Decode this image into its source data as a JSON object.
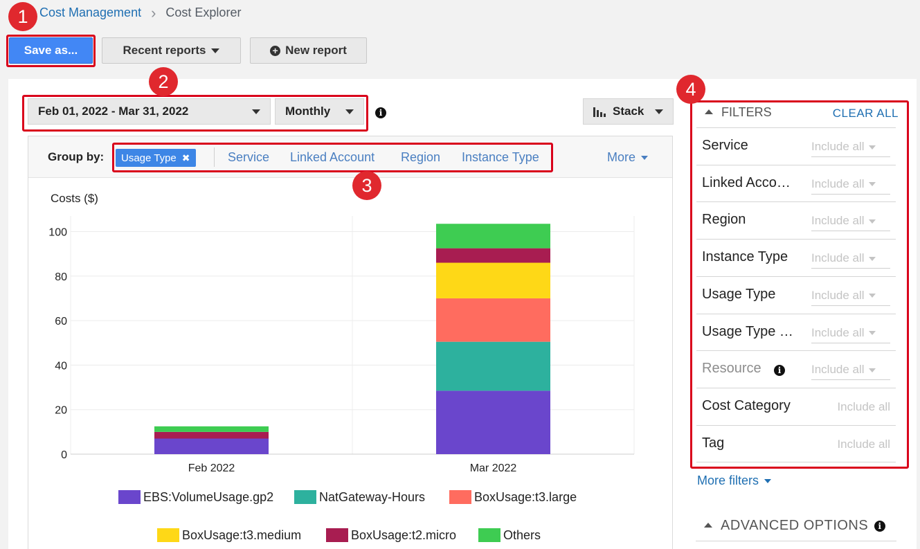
{
  "breadcrumb": {
    "parent": "Cost Management",
    "current": "Cost Explorer"
  },
  "toolbar": {
    "save_label": "Save as...",
    "recent_label": "Recent reports",
    "new_label": "New report"
  },
  "controls": {
    "date_range": "Feb 01, 2022 - Mar 31, 2022",
    "granularity": "Monthly",
    "chart_style": "Stack"
  },
  "group_by": {
    "label": "Group by:",
    "active_chip": "Usage Type",
    "options": [
      "Service",
      "Linked Account",
      "Region",
      "Instance Type"
    ],
    "more": "More"
  },
  "badges": [
    "1",
    "2",
    "3",
    "4"
  ],
  "chart_data": {
    "type": "bar",
    "stacked": true,
    "ylabel": "Costs ($)",
    "categories": [
      "Feb 2022",
      "Mar 2022"
    ],
    "yticks": [
      0,
      20,
      40,
      60,
      80,
      100
    ],
    "ylim": [
      0,
      107
    ],
    "grid": true,
    "legend_position": "bottom",
    "series": [
      {
        "name": "EBS:VolumeUsage.gp2",
        "color": "#6a46cc",
        "values": [
          7,
          28.5
        ]
      },
      {
        "name": "NatGateway-Hours",
        "color": "#2db19e",
        "values": [
          0,
          22
        ]
      },
      {
        "name": "BoxUsage:t3.large",
        "color": "#ff6c5f",
        "values": [
          0,
          19.5
        ]
      },
      {
        "name": "BoxUsage:t3.medium",
        "color": "#fed817",
        "values": [
          0,
          16
        ]
      },
      {
        "name": "BoxUsage:t2.micro",
        "color": "#a81d51",
        "values": [
          3,
          6.5
        ]
      },
      {
        "name": "Others",
        "color": "#3ecc52",
        "values": [
          2.5,
          11
        ]
      }
    ]
  },
  "filters": {
    "title": "FILTERS",
    "clear_all": "CLEAR ALL",
    "rows": [
      {
        "label": "Service",
        "value": "Include all"
      },
      {
        "label": "Linked Acco…",
        "value": "Include all"
      },
      {
        "label": "Region",
        "value": "Include all"
      },
      {
        "label": "Instance Type",
        "value": "Include all"
      },
      {
        "label": "Usage Type",
        "value": "Include all"
      },
      {
        "label": "Usage Type …",
        "value": "Include all"
      },
      {
        "label": "Resource",
        "value": "Include all"
      },
      {
        "label": "Cost Category",
        "value": "Include all"
      },
      {
        "label": "Tag",
        "value": "Include all"
      }
    ],
    "more_filters": "More filters",
    "advanced": "ADVANCED OPTIONS"
  }
}
